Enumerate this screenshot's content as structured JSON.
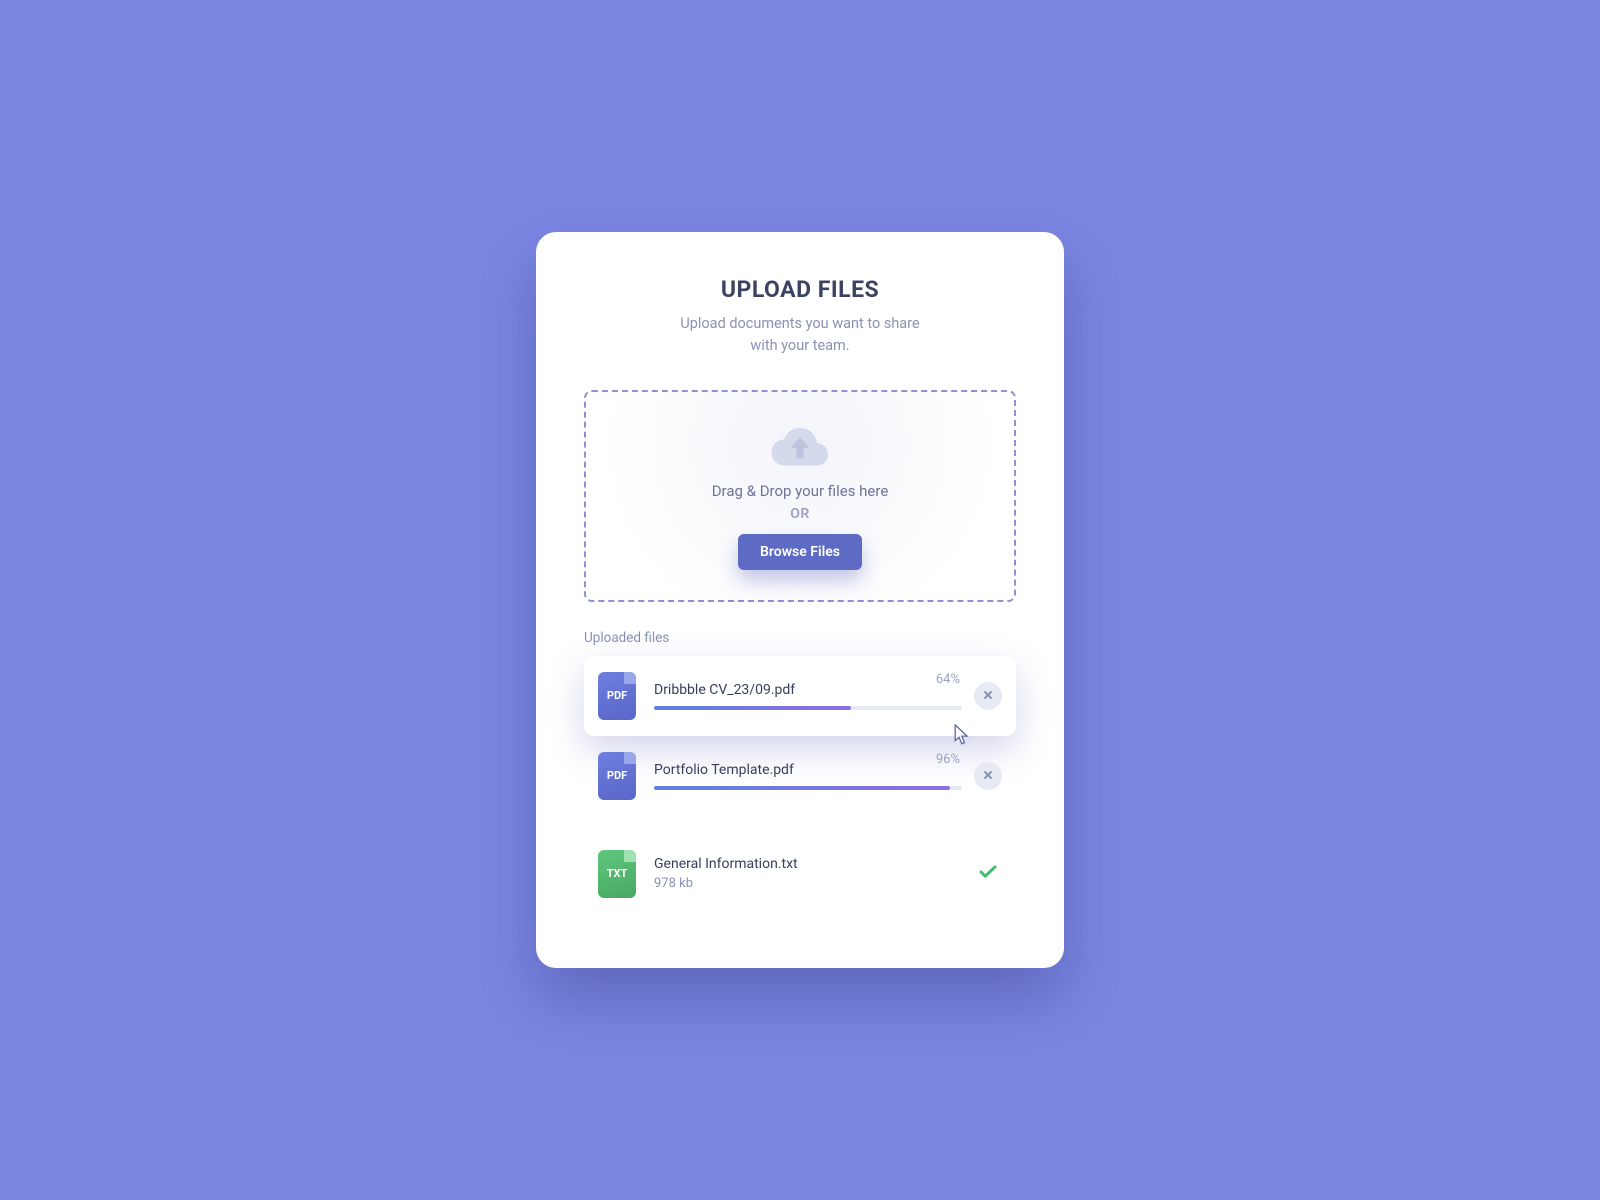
{
  "header": {
    "title": "UPLOAD FILES",
    "subtitle_line1": "Upload documents you want to share",
    "subtitle_line2": "with your team."
  },
  "dropzone": {
    "drag_text": "Drag & Drop your files here",
    "or_text": "OR",
    "browse_label": "Browse Files"
  },
  "uploaded_section_label": "Uploaded files",
  "files": [
    {
      "name": "Dribbble CV_23/09.pdf",
      "type_label": "PDF",
      "color": "blue",
      "status": "uploading",
      "progress": 64,
      "progress_label": "64%"
    },
    {
      "name": "Portfolio Template.pdf",
      "type_label": "PDF",
      "color": "blue",
      "status": "uploading",
      "progress": 96,
      "progress_label": "96%"
    },
    {
      "name": "General Information.txt",
      "type_label": "TXT",
      "color": "green",
      "status": "done",
      "size_label": "978 kb"
    }
  ],
  "colors": {
    "bg": "#7b86e2",
    "accent": "#5d6bc4"
  }
}
